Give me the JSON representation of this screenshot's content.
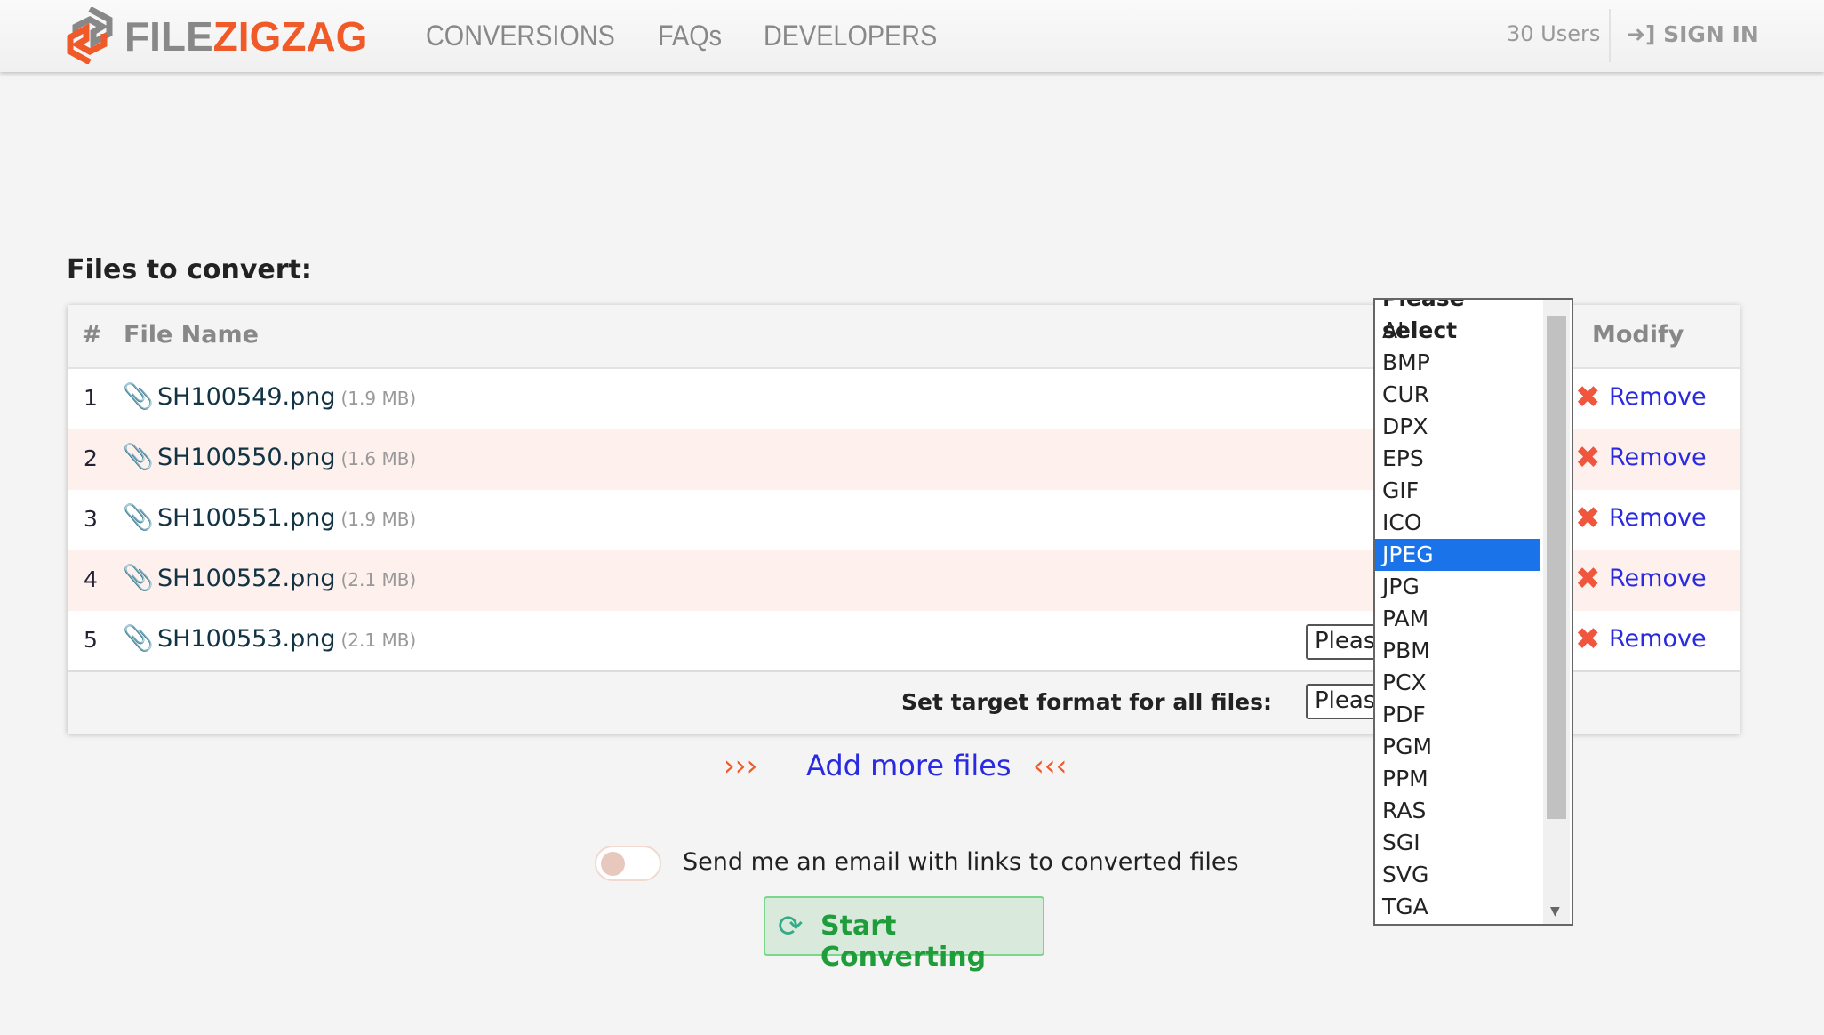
{
  "header": {
    "logo_prefix": "FILE",
    "logo_suffix": "ZIGZAG",
    "nav": [
      "CONVERSIONS",
      "FAQs",
      "DEVELOPERS"
    ],
    "users": "30 Users",
    "sign_in": "SIGN IN"
  },
  "main": {
    "title": "Files to convert:",
    "columns": {
      "num": "#",
      "file_name": "File Name",
      "modify": "Modify"
    },
    "files": [
      {
        "num": "1",
        "name": "SH100549.png",
        "size": "(1.9 MB)"
      },
      {
        "num": "2",
        "name": "SH100550.png",
        "size": "(1.6 MB)"
      },
      {
        "num": "3",
        "name": "SH100551.png",
        "size": "(1.9 MB)"
      },
      {
        "num": "4",
        "name": "SH100552.png",
        "size": "(2.1 MB)"
      },
      {
        "num": "5",
        "name": "SH100553.png",
        "size": "(2.1 MB)"
      }
    ],
    "remove_label": "Remove",
    "select_placeholder": "Please select",
    "set_all_label": "Set target format for all files:",
    "dropdown_options": [
      "Please select",
      "AI",
      "BMP",
      "CUR",
      "DPX",
      "EPS",
      "GIF",
      "ICO",
      "JPEG",
      "JPG",
      "PAM",
      "PBM",
      "PCX",
      "PDF",
      "PGM",
      "PPM",
      "RAS",
      "SGI",
      "SVG",
      "TGA"
    ],
    "dropdown_highlighted": "JPEG",
    "add_more": "Add more files",
    "arrows_left": "›››",
    "arrows_right": "‹‹‹",
    "email_toggle_label": "Send me an email with links to converted files",
    "email_toggle_on": false,
    "start_button": "Start Converting"
  },
  "colors": {
    "brand_orange": "#f05a28",
    "link_blue": "#2a2ae0",
    "highlight": "#1a73e8",
    "start_green": "#1f9d3a"
  }
}
